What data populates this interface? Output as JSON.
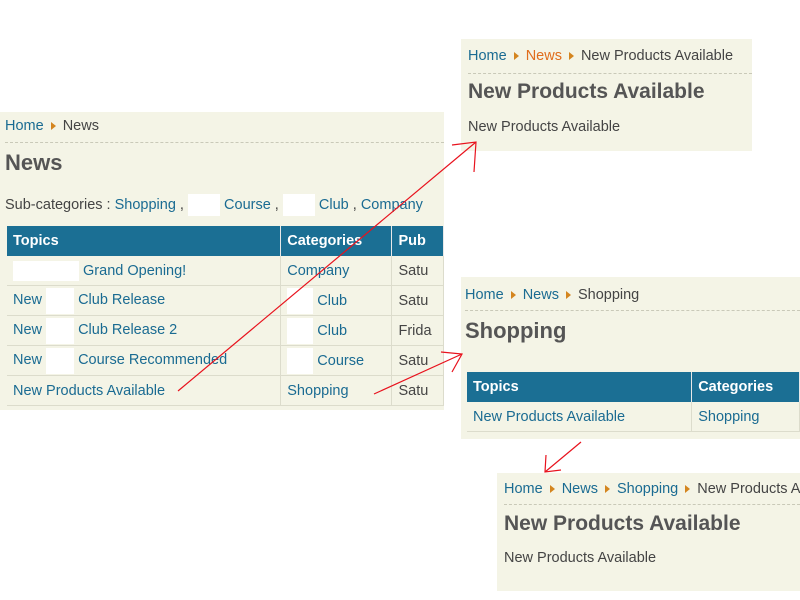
{
  "news_page": {
    "breadcrumb": [
      {
        "label": "Home",
        "link": true
      },
      {
        "label": "News",
        "link": false
      }
    ],
    "title": "News",
    "subcategories_label": "Sub-categories :",
    "subcategories": [
      "Shopping",
      "Course",
      "Club",
      "Company"
    ],
    "columns": [
      "Topics",
      "Categories",
      "Pub"
    ],
    "rows": [
      {
        "topic": "Grand Opening!",
        "category": "Company",
        "date": "Satu"
      },
      {
        "topic": "New",
        "topic_after": "Club Release",
        "category": "Club",
        "date": "Satu"
      },
      {
        "topic": "New",
        "topic_after": "Club Release 2",
        "category": "Club",
        "date": "Frida"
      },
      {
        "topic": "New",
        "topic_after": "Course Recommended",
        "category": "Course",
        "date": "Satu"
      },
      {
        "topic": "New Products Available",
        "category": "Shopping",
        "date": "Satu"
      }
    ]
  },
  "article_page_1": {
    "breadcrumb": [
      "Home",
      "News",
      "New Products Available"
    ],
    "title": "New Products Available",
    "body": "New Products Available"
  },
  "shopping_page": {
    "breadcrumb": [
      "Home",
      "News",
      "Shopping"
    ],
    "title": "Shopping",
    "columns": [
      "Topics",
      "Categories"
    ],
    "rows": [
      {
        "topic": "New Products Available",
        "category": "Shopping"
      }
    ]
  },
  "article_page_2": {
    "breadcrumb": [
      "Home",
      "News",
      "Shopping",
      "New Products A"
    ],
    "title": "New Products Available",
    "body": "New Products Available"
  },
  "colors": {
    "link": "#1a6b92",
    "header": "#1b6f94",
    "active_crumb": "#e06d1c",
    "arrow": "#e8121d",
    "panel": "#f4f4e6"
  }
}
